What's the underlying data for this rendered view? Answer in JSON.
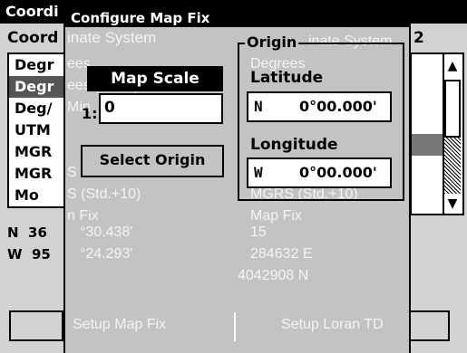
{
  "background_window": {
    "title": "Coordi",
    "heading_left": "Coord",
    "heading_right": "2",
    "list_left": [
      "Degr",
      "Degr",
      "Deg/",
      "UTM",
      "MGR",
      "MGR",
      "Mo"
    ],
    "ghost_heading": "inate System",
    "ghost_heading_right": "inate System",
    "ghost_items": [
      "ees",
      "ees (Hddd)",
      "Min",
      "",
      "S",
      "S (Std.+10)",
      "n Fix"
    ],
    "ghost_right_items": [
      "Degrees",
      "MGRS (Std.+10)",
      "Map Fix"
    ],
    "lat_row": {
      "hemi": "N",
      "deg": "36",
      "ghost": "°30.438'",
      "ghost_right": "15"
    },
    "lon_row": {
      "hemi": "W",
      "deg": "95",
      "ghost": "°24.293'",
      "ghost_right": "284632 E"
    },
    "ghost_extra": "4042908 N",
    "button_left_ghost": "Setup Map Fix",
    "button_right_ghost": "Setup Loran TD"
  },
  "dialog": {
    "title": "Configure Map Fix",
    "map_scale": {
      "header": "Map Scale",
      "prefix": "1:",
      "value": "0"
    },
    "select_origin_label": "Select Origin",
    "origin": {
      "group_label": "Origin",
      "latitude_label": "Latitude",
      "latitude_hemi": "N",
      "latitude_value": "0°00.000'",
      "longitude_label": "Longitude",
      "longitude_hemi": "W",
      "longitude_value": "0°00.000'"
    }
  }
}
